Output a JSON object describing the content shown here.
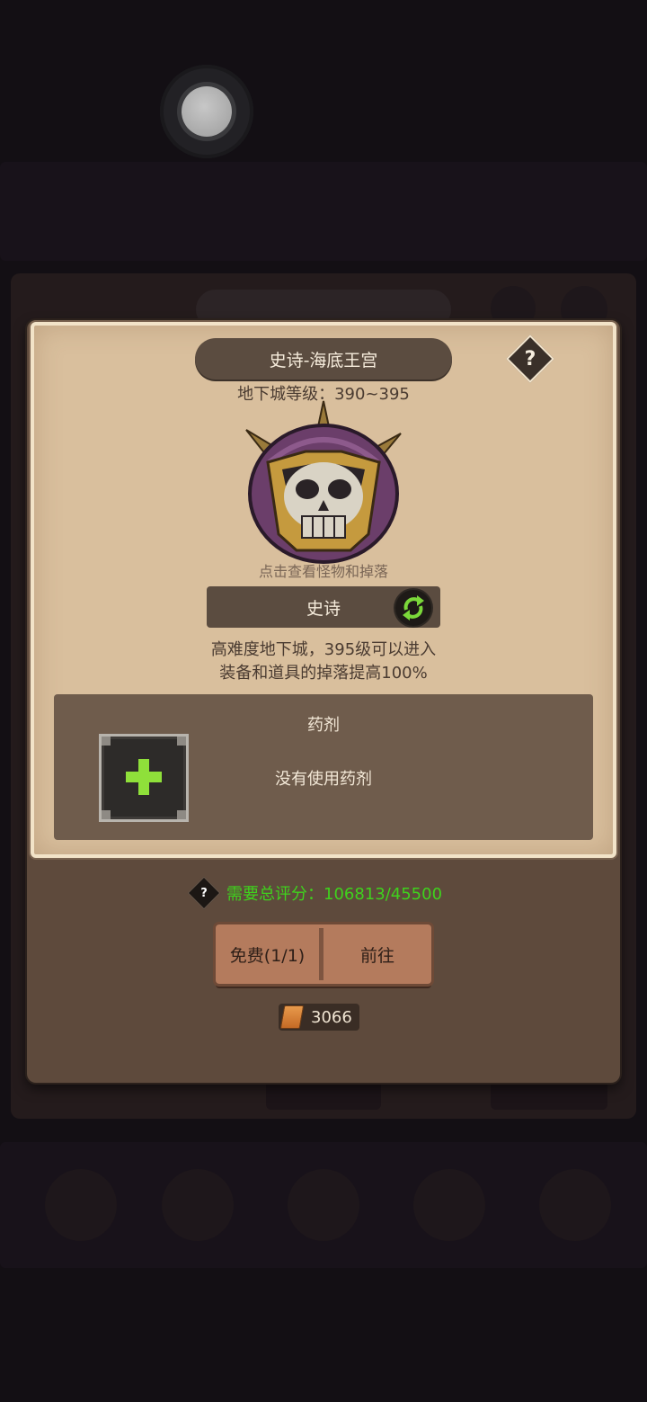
{
  "dialog": {
    "title": "史诗-海底王宫",
    "help_symbol": "?",
    "dungeon_level": "地下城等级：390~395",
    "boss_hint": "点击查看怪物和掉落",
    "difficulty": "史诗",
    "description_line1": "高难度地下城，395级可以进入",
    "description_line2": "装备和道具的掉落提高100%"
  },
  "potion": {
    "title": "药剂",
    "status": "没有使用药剂"
  },
  "requirement": {
    "help_symbol": "?",
    "text": "需要总评分：106813/45500",
    "color": "#3fd21d"
  },
  "actions": {
    "free_label": "免费(1/1)",
    "go_label": "前往"
  },
  "currency": {
    "icon": "scroll-icon",
    "amount": "3066"
  }
}
